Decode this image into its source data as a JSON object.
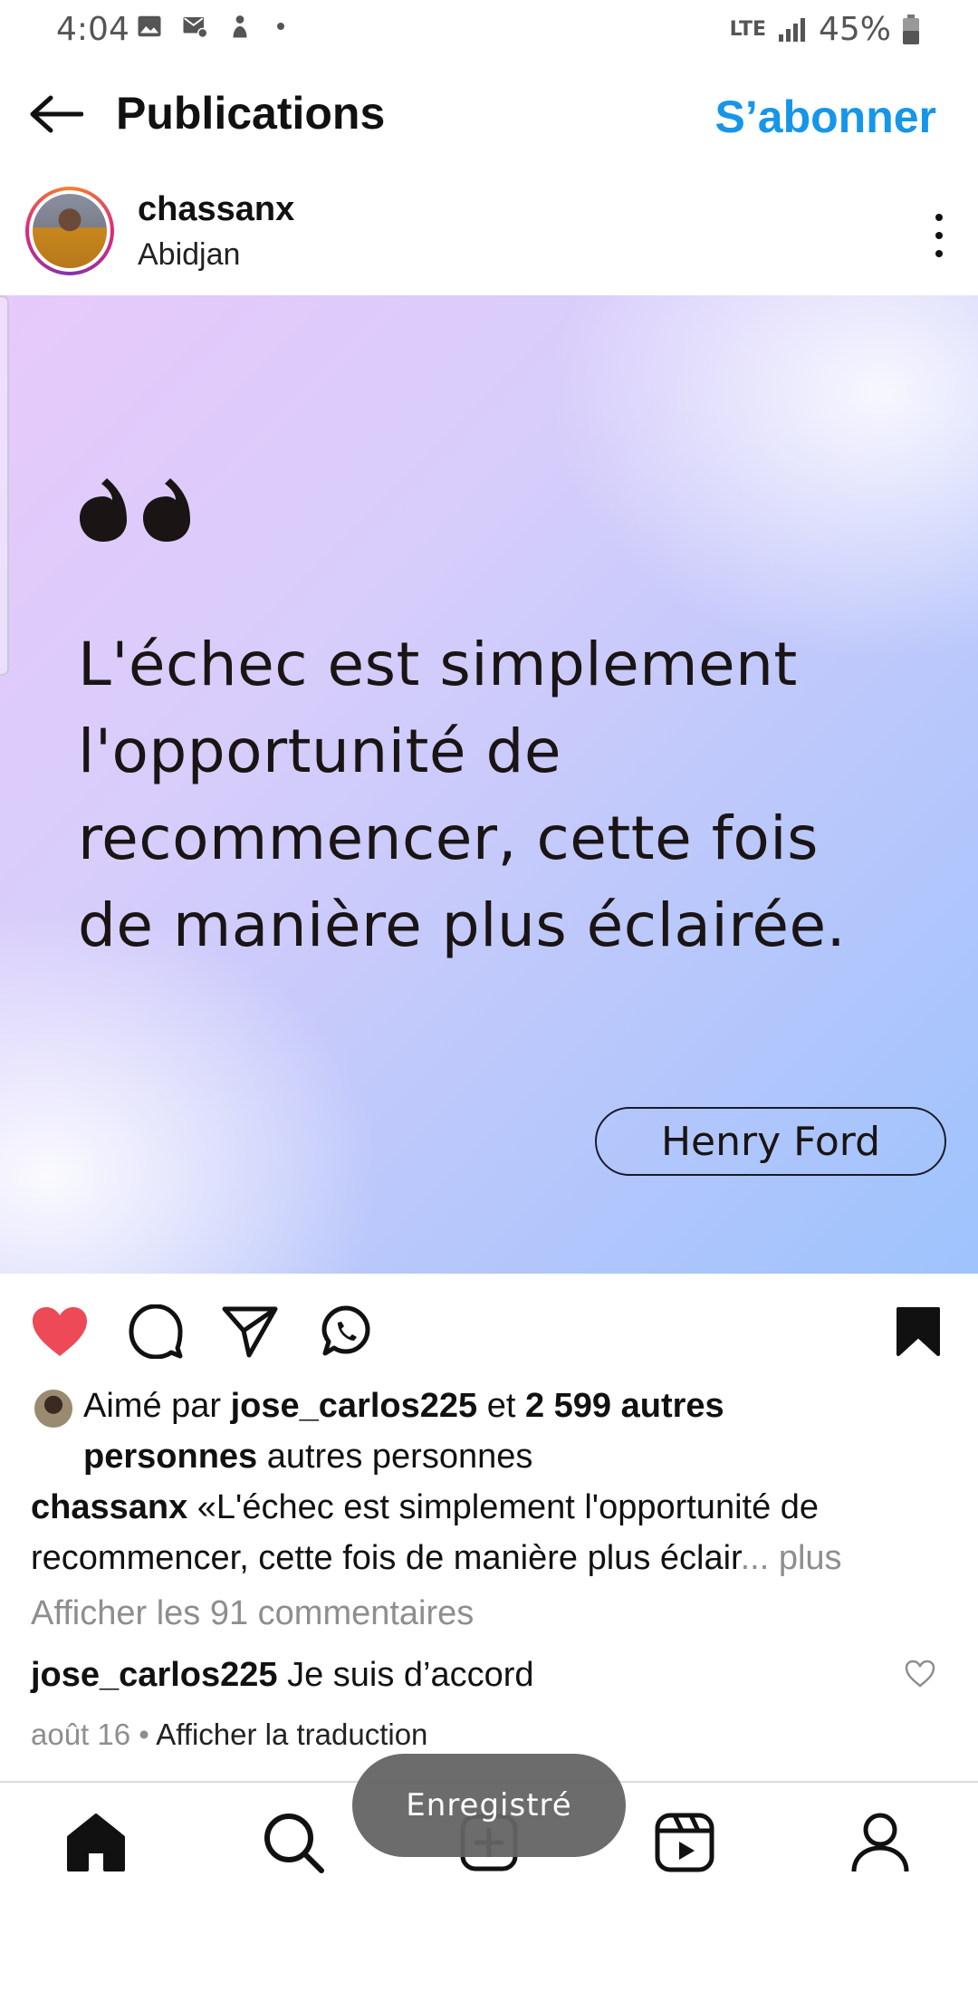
{
  "status_bar": {
    "time": "4:04",
    "network": "LTE",
    "battery": "45%"
  },
  "header": {
    "title": "Publications",
    "subscribe_label": "S’abonner",
    "accent_color": "#1696e8"
  },
  "post": {
    "username": "chassanx",
    "location": "Abidjan",
    "image": {
      "quote_lines": [
        "L'échec est simplement",
        "l'opportunité de",
        "recommencer, cette fois",
        "de manière plus éclairée."
      ],
      "author": "Henry Ford"
    },
    "actions": {
      "liked": true,
      "saved": true,
      "like_color": "#ed4956"
    },
    "likes": {
      "prefix": "Aimé par ",
      "user": "jose_carlos225",
      "connector": " et ",
      "count_text": "2 599 autres",
      "line2_bold": "personnes",
      "line2_rest": " autres personnes"
    },
    "caption": {
      "user": "chassanx",
      "text_line1": " «L'échec est simplement l'opportunité de",
      "text_line2": "recommencer, cette fois de manière plus éclair",
      "more": "... plus"
    },
    "view_comments": "Afficher les 91 commentaires",
    "comment": {
      "user": "jose_carlos225",
      "text": " Je suis d’accord",
      "date": "août 16",
      "separator": " • ",
      "translate": "Afficher la traduction"
    }
  },
  "toast": "Enregistré",
  "bottom_nav": [
    "home-icon",
    "search-icon",
    "create-icon",
    "reels-icon",
    "profile-icon"
  ]
}
